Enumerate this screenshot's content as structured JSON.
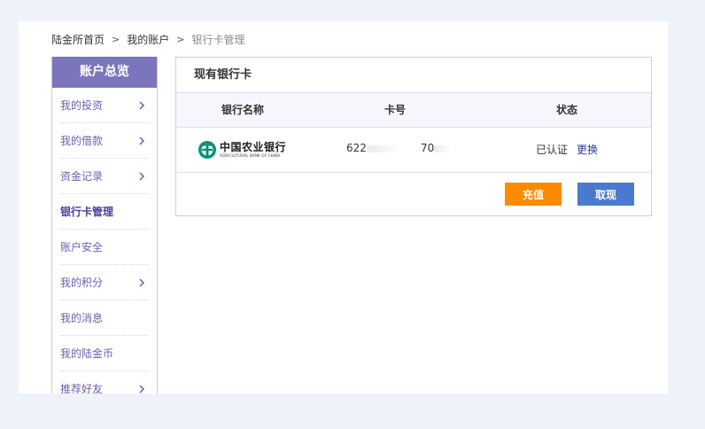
{
  "breadcrumb": {
    "items": [
      "陆金所首页",
      "我的账户",
      "银行卡管理"
    ],
    "separator": ">"
  },
  "sidebar": {
    "header": "账户总览",
    "items": [
      {
        "label": "我的投资",
        "has_arrow": true
      },
      {
        "label": "我的借款",
        "has_arrow": true
      },
      {
        "label": "资金记录",
        "has_arrow": true
      },
      {
        "label": "银行卡管理",
        "has_arrow": false,
        "active": true
      },
      {
        "label": "账户安全",
        "has_arrow": false
      },
      {
        "label": "我的积分",
        "has_arrow": true
      },
      {
        "label": "我的消息",
        "has_arrow": false
      },
      {
        "label": "我的陆金币",
        "has_arrow": false
      },
      {
        "label": "推荐好友",
        "has_arrow": true
      }
    ]
  },
  "panel": {
    "title": "现有银行卡",
    "columns": [
      "银行名称",
      "卡号",
      "状态"
    ],
    "row": {
      "bank_name_cn": "中国农业银行",
      "bank_name_en": "AGRICULTURAL BANK OF CHINA",
      "card_prefix": "622",
      "card_suffix": "70",
      "status": "已认证",
      "action": "更换"
    },
    "buttons": {
      "recharge": "充值",
      "withdraw": "取现"
    }
  },
  "colors": {
    "sidebar_header": "#7b75bd",
    "recharge_button": "#ff8a00",
    "withdraw_button": "#4a7ad0",
    "link": "#2e3a9a",
    "bank_logo": "#0f8f7d"
  },
  "icons": {
    "sidebar_arrow": "chevron-right-icon",
    "bank_logo": "agricultural-bank-logo-icon"
  }
}
